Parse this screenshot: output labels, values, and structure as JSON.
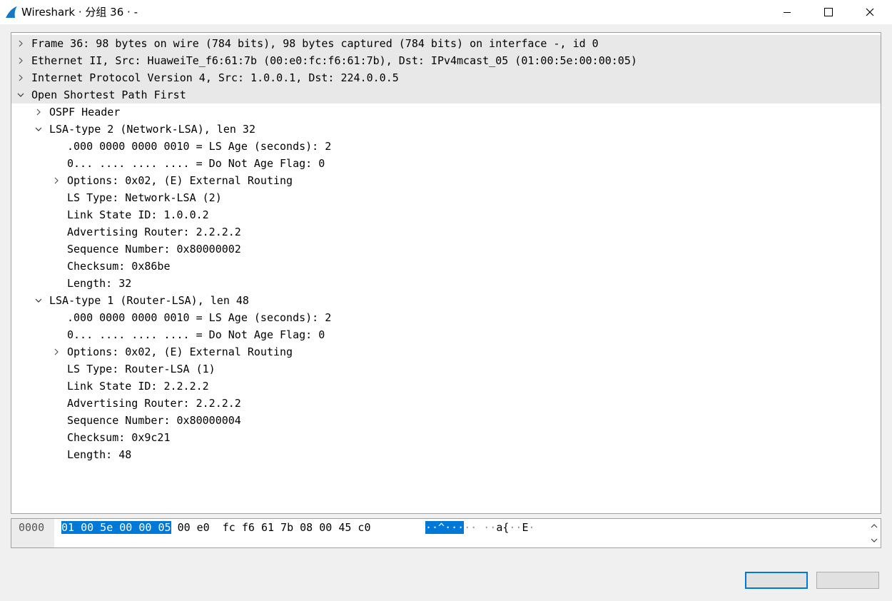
{
  "window": {
    "title": "Wireshark · 分组 36 · -",
    "accent_color": "#0078d7"
  },
  "tree": [
    {
      "level": 0,
      "arrow": "collapsed",
      "text": "Frame 36: 98 bytes on wire (784 bits), 98 bytes captured (784 bits) on interface -, id 0"
    },
    {
      "level": 0,
      "arrow": "collapsed",
      "text": "Ethernet II, Src: HuaweiTe_f6:61:7b (00:e0:fc:f6:61:7b), Dst: IPv4mcast_05 (01:00:5e:00:00:05)"
    },
    {
      "level": 0,
      "arrow": "collapsed",
      "text": "Internet Protocol Version 4, Src: 1.0.0.1, Dst: 224.0.0.5"
    },
    {
      "level": 0,
      "arrow": "expanded",
      "text": "Open Shortest Path First"
    },
    {
      "level": 1,
      "arrow": "collapsed",
      "text": "OSPF Header"
    },
    {
      "level": 1,
      "arrow": "expanded",
      "text": "LSA-type 2 (Network-LSA), len 32"
    },
    {
      "level": 2,
      "arrow": "none",
      "text": ".000 0000 0000 0010 = LS Age (seconds): 2"
    },
    {
      "level": 2,
      "arrow": "none",
      "text": "0... .... .... .... = Do Not Age Flag: 0"
    },
    {
      "level": 2,
      "arrow": "collapsed",
      "text": "Options: 0x02, (E) External Routing"
    },
    {
      "level": 2,
      "arrow": "none",
      "text": "LS Type: Network-LSA (2)"
    },
    {
      "level": 2,
      "arrow": "none",
      "text": "Link State ID: 1.0.0.2"
    },
    {
      "level": 2,
      "arrow": "none",
      "text": "Advertising Router: 2.2.2.2"
    },
    {
      "level": 2,
      "arrow": "none",
      "text": "Sequence Number: 0x80000002"
    },
    {
      "level": 2,
      "arrow": "none",
      "text": "Checksum: 0x86be"
    },
    {
      "level": 2,
      "arrow": "none",
      "text": "Length: 32"
    },
    {
      "level": 1,
      "arrow": "expanded",
      "text": "LSA-type 1 (Router-LSA), len 48"
    },
    {
      "level": 2,
      "arrow": "none",
      "text": ".000 0000 0000 0010 = LS Age (seconds): 2"
    },
    {
      "level": 2,
      "arrow": "none",
      "text": "0... .... .... .... = Do Not Age Flag: 0"
    },
    {
      "level": 2,
      "arrow": "collapsed",
      "text": "Options: 0x02, (E) External Routing"
    },
    {
      "level": 2,
      "arrow": "none",
      "text": "LS Type: Router-LSA (1)"
    },
    {
      "level": 2,
      "arrow": "none",
      "text": "Link State ID: 2.2.2.2"
    },
    {
      "level": 2,
      "arrow": "none",
      "text": "Advertising Router: 2.2.2.2"
    },
    {
      "level": 2,
      "arrow": "none",
      "text": "Sequence Number: 0x80000004"
    },
    {
      "level": 2,
      "arrow": "none",
      "text": "Checksum: 0x9c21"
    },
    {
      "level": 2,
      "arrow": "none",
      "text": "Length: 48"
    }
  ],
  "hex": {
    "offset": "0000",
    "bytes_selected": "01 00 5e 00 00 05",
    "bytes_rest": "00 e0  fc f6 61 7b 08 00 45 c0",
    "ascii_selected": "··^···",
    "ascii_rest_a": "··",
    "ascii_rest_b": " ··",
    "ascii_rest_c": "a{",
    "ascii_rest_d": "··",
    "ascii_rest_e": "E",
    "ascii_rest_f": "·"
  },
  "buttons": {
    "ok_label": "",
    "cancel_label": ""
  }
}
